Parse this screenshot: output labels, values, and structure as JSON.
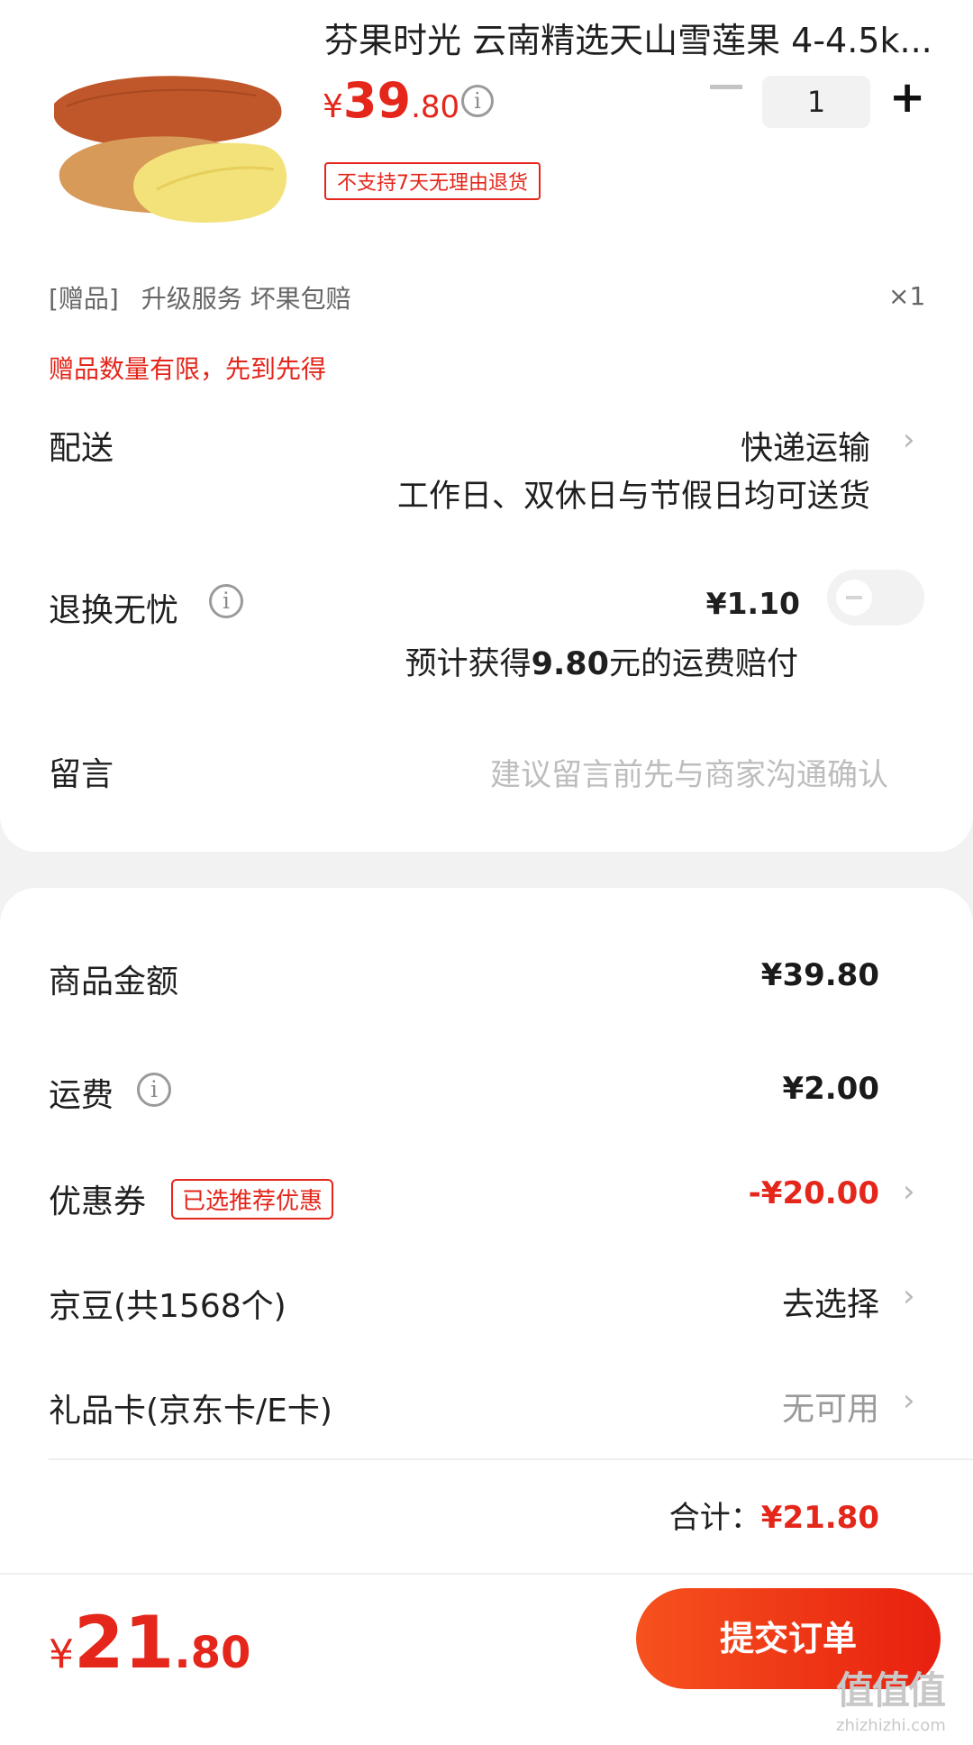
{
  "product": {
    "title": "芬果时光 云南精选天山雪莲果 4-4.5k...",
    "price_symbol": "¥",
    "price_int": "39",
    "price_dec": ".80",
    "quantity": "1",
    "return_policy": "不支持7天无理由退货",
    "image_icon": "snow-lotus-fruit-image"
  },
  "gift": {
    "tag": "[赠品]",
    "name": "升级服务 坏果包赔",
    "count": "×1",
    "limit_note": "赠品数量有限，先到先得"
  },
  "delivery": {
    "label": "配送",
    "method": "快递运输",
    "note": "工作日、双休日与节假日均可送货"
  },
  "return_worry_free": {
    "label": "退换无忧",
    "price": "¥1.10",
    "note_prefix": "预计获得",
    "note_amount": "9.80",
    "note_suffix": "元的运费赔付",
    "enabled": false
  },
  "message": {
    "label": "留言",
    "placeholder": "建议留言前先与商家沟通确认"
  },
  "summary": {
    "goods_label": "商品金额",
    "goods_value": "¥39.80",
    "shipping_label": "运费",
    "shipping_value": "¥2.00",
    "coupon_label": "优惠券",
    "coupon_tag": "已选推荐优惠",
    "coupon_value": "-¥20.00",
    "beans_label": "京豆(共1568个)",
    "beans_value": "去选择",
    "giftcard_label": "礼品卡(京东卡/E卡)",
    "giftcard_value": "无可用",
    "total_label": "合计：",
    "total_value": "¥21.80"
  },
  "bottom": {
    "price_symbol": "¥",
    "price_int": "21",
    "price_dec": ".80",
    "submit_label": "提交订单"
  },
  "watermark": {
    "text": "值值值",
    "url": "zhizhizhi.com"
  },
  "colors": {
    "accent": "#e4261b",
    "button_start": "#f6521e",
    "button_end": "#e8200f"
  }
}
